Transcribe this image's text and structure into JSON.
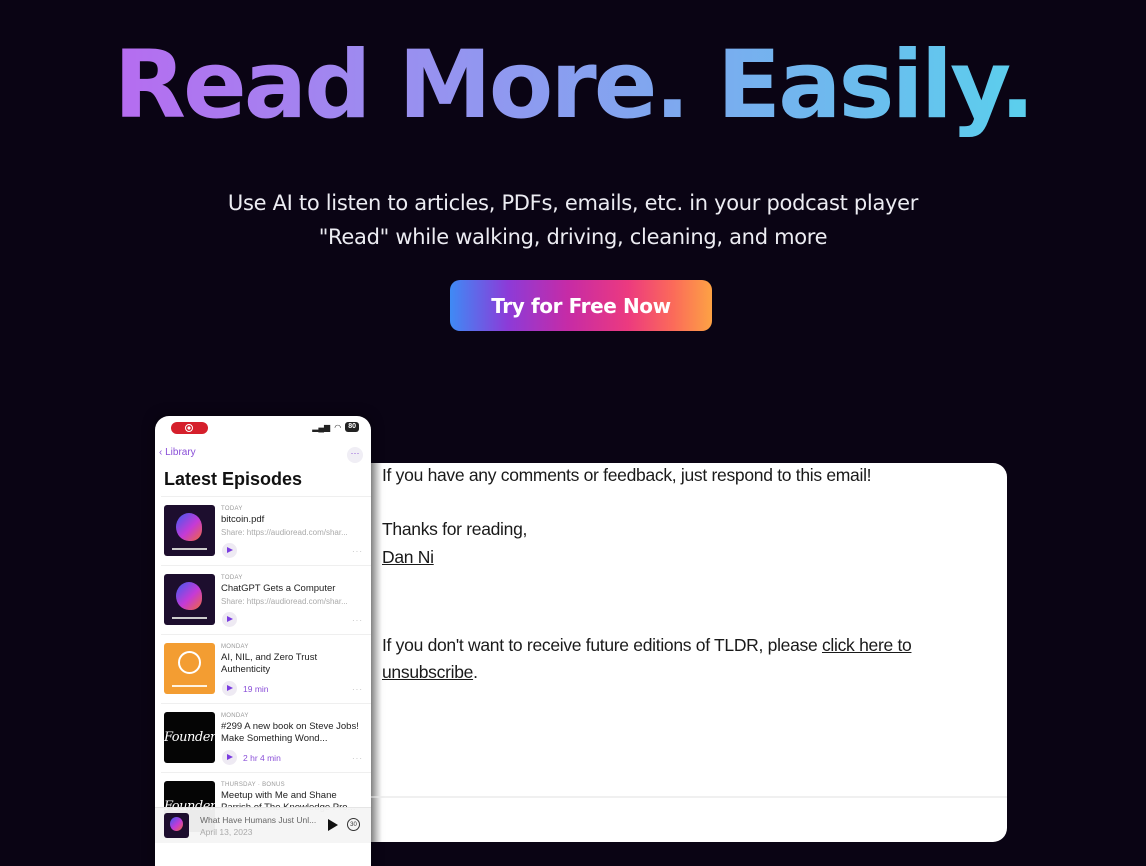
{
  "hero": {
    "title": "Read More. Easily.",
    "subtitle_line1": "Use AI to listen to articles, PDFs, emails, etc. in your podcast player",
    "subtitle_line2": "\"Read\" while walking, driving, cleaning, and more",
    "cta_label": "Try for Free Now"
  },
  "colors": {
    "background": "#0a0414",
    "title_gradient": [
      "#c15ef0",
      "#9a8ff0",
      "#7aacef",
      "#4fdcec"
    ],
    "cta_gradient": [
      "#3f8af5",
      "#8c3bd8",
      "#c62ba6",
      "#ec3a7f",
      "#fda244"
    ],
    "accent_purple": "#8a4fd8"
  },
  "phone": {
    "battery": "80",
    "back_label": "Library",
    "more_icon": "ellipsis-icon",
    "heading": "Latest Episodes",
    "episodes": [
      {
        "day": "TODAY",
        "title": "bitcoin.pdf",
        "desc": "Share: https://audioread.com/shar...",
        "duration": "",
        "art": "audioread"
      },
      {
        "day": "TODAY",
        "title": "ChatGPT Gets a Computer",
        "desc": "Share: https://audioread.com/shar...",
        "duration": "",
        "art": "audioread"
      },
      {
        "day": "MONDAY",
        "title": "AI, NIL, and Zero Trust Authenticity",
        "desc": "",
        "duration": "19 min",
        "art": "stratechery"
      },
      {
        "day": "MONDAY",
        "title": "#299 A new book on Steve Jobs! Make Something Wond...",
        "desc": "",
        "duration": "2 hr 4 min",
        "art": "founders"
      },
      {
        "day": "THURSDAY · BONUS",
        "title": "Meetup with Me and Shane Parrish of The Knowledge Pro...",
        "desc": "",
        "duration": "",
        "art": "founders"
      }
    ],
    "founders_art_text": "Founders",
    "now_playing": {
      "title": "What Have Humans Just Unl...",
      "date": "April 13, 2023",
      "skip_label": "30"
    }
  },
  "email": {
    "line1": "If you have any comments or feedback, just respond to this email!",
    "line2": "Thanks for reading,",
    "signature": "Dan Ni",
    "unsub_text": "If you don't want to receive future editions of TLDR, please ",
    "unsub_link": "click here to unsubscribe",
    "unsub_end": "."
  }
}
